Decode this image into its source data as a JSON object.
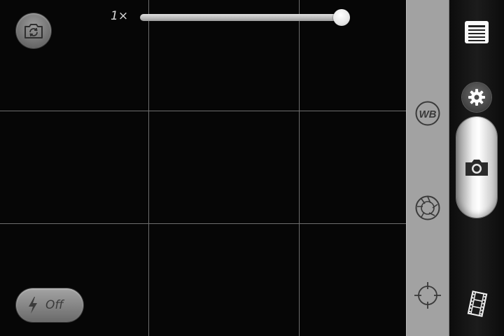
{
  "zoom": {
    "label": "1×",
    "level": 1.0
  },
  "flash": {
    "state_label": "Off",
    "icon": "lightning-bolt-icon"
  },
  "top_controls": {
    "flip_camera_icon": "switch-camera-icon"
  },
  "side_panel": {
    "white_balance_label": "WB",
    "exposure_icon": "aperture-icon",
    "focus_icon": "crosshair-icon"
  },
  "control_bar": {
    "menu_icon": "menu-list-icon",
    "settings_icon": "gear-icon",
    "shutter_icon": "camera-icon",
    "video_mode_icon": "film-strip-icon"
  },
  "colors": {
    "panel_gray": "#a2a2a2",
    "grid_line": "#6e6e6e",
    "control_bar": "#141414"
  }
}
